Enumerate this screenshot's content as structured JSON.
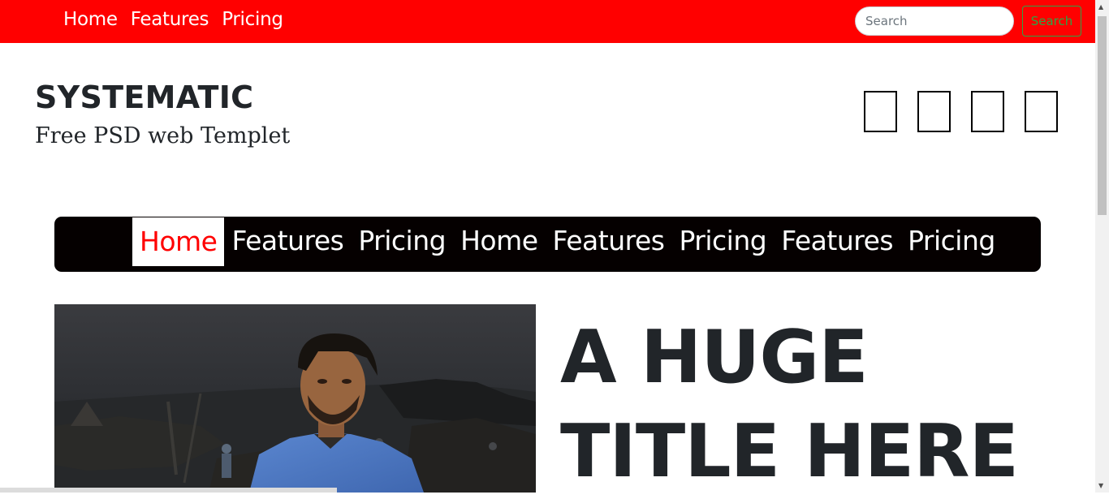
{
  "topbar": {
    "nav": [
      "Home",
      "Features",
      "Pricing"
    ],
    "search_placeholder": "Search",
    "search_button": "Search"
  },
  "brand": {
    "name": "SYSTEMATIC",
    "tagline": "Free PSD web Templet"
  },
  "social_icons": [
    "social-icon",
    "social-icon",
    "social-icon",
    "social-icon"
  ],
  "mainnav": {
    "items": [
      "Home",
      "Features",
      "Pricing",
      "Home",
      "Features",
      "Pricing",
      "Features",
      "Pricing"
    ],
    "active_index": 0
  },
  "hero": {
    "title_line1": "A HUGE",
    "title_line2": "TITLE HERE"
  },
  "colors": {
    "topbar_bg": "#ff0000",
    "mainnav_bg": "#050000",
    "active_text": "#ff0000",
    "search_button": "#28a745"
  }
}
